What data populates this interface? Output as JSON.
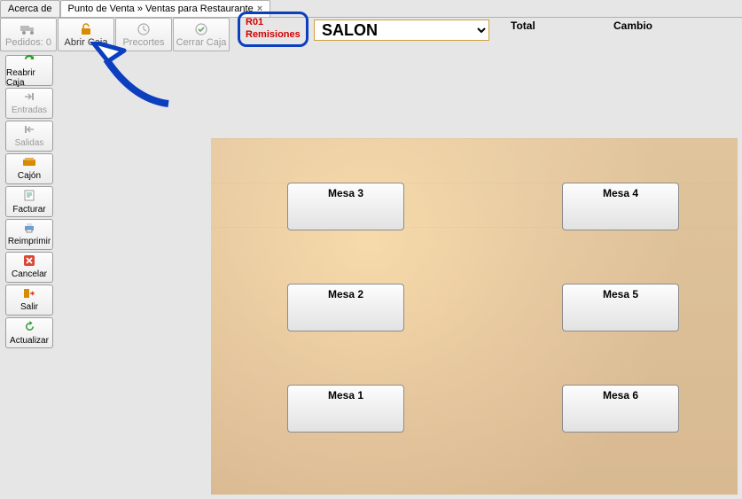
{
  "tabs": {
    "about": "Acerca de",
    "main": "Punto de Venta » Ventas para Restaurante"
  },
  "toolbar": {
    "pedidos": "Pedidos: 0",
    "abrir": "Abrir Caja",
    "precortes": "Precortes",
    "cerrar": "Cerrar Caja"
  },
  "remisiones": {
    "line1": "R01",
    "line2": "Remisiones"
  },
  "salon_selected": "SALON",
  "labels": {
    "total": "Total",
    "cambio": "Cambio"
  },
  "sidebar": {
    "reabrir": "Reabrir Caja",
    "entradas": "Entradas",
    "salidas": "Salidas",
    "cajon": "Cajón",
    "facturar": "Facturar",
    "reimprimir": "Reimprimir",
    "cancelar": "Cancelar",
    "salir": "Salir",
    "actualizar": "Actualizar"
  },
  "mesas": {
    "m1": "Mesa 1",
    "m2": "Mesa 2",
    "m3": "Mesa 3",
    "m4": "Mesa 4",
    "m5": "Mesa 5",
    "m6": "Mesa 6"
  }
}
